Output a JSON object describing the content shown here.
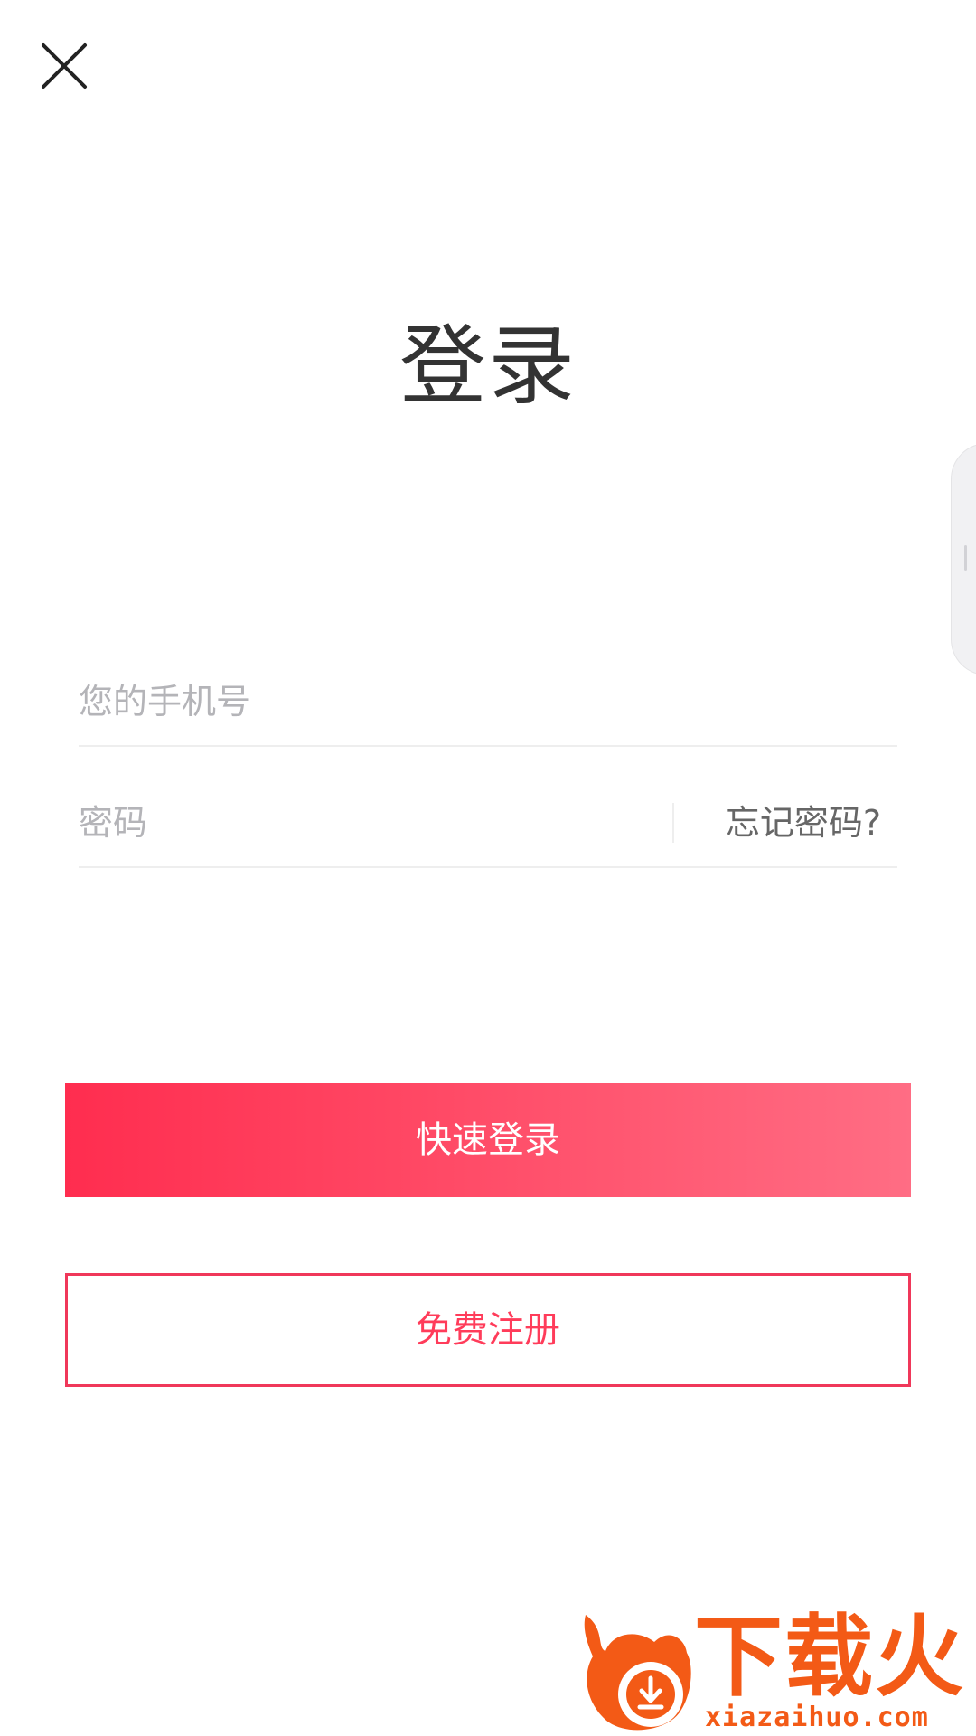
{
  "header": {
    "close_icon": "close-icon"
  },
  "page": {
    "title": "登录"
  },
  "form": {
    "phone_placeholder": "您的手机号",
    "password_placeholder": "密码",
    "forgot_password": "忘记密码?"
  },
  "actions": {
    "login_label": "快速登录",
    "register_label": "免费注册"
  },
  "watermark": {
    "brand": "下载火",
    "domain": "xiazaihuo.com",
    "icon": "download-flame-icon"
  },
  "colors": {
    "accent": "#ff3c5a",
    "gradient_start": "#ff2d4f",
    "gradient_end": "#ff6d84",
    "watermark": "#f35a16"
  }
}
